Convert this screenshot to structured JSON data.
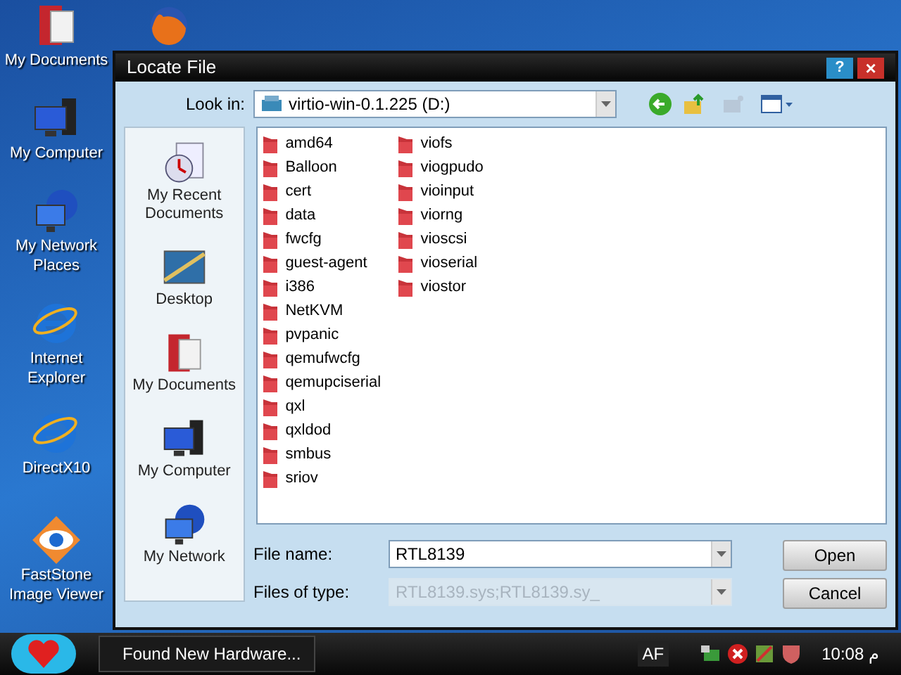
{
  "desktop_icons": [
    {
      "label": "My Documents",
      "kind": "documents"
    },
    {
      "label": "My Computer",
      "kind": "computer"
    },
    {
      "label": "My Network Places",
      "kind": "network"
    },
    {
      "label": "Internet Explorer",
      "kind": "ie"
    },
    {
      "label": "DirectX10",
      "kind": "ie-shortcut"
    },
    {
      "label": "FastStone Image Viewer",
      "kind": "eye"
    }
  ],
  "dialog": {
    "title": "Locate File",
    "help_button": "?",
    "close_button": "×",
    "look_in": {
      "label": "Look in:",
      "value": "virtio-win-0.1.225 (D:)"
    },
    "places": [
      {
        "label": "My Recent Documents",
        "kind": "recent"
      },
      {
        "label": "Desktop",
        "kind": "desktop"
      },
      {
        "label": "My Documents",
        "kind": "documents"
      },
      {
        "label": "My Computer",
        "kind": "computer"
      },
      {
        "label": "My Network",
        "kind": "network"
      }
    ],
    "files": [
      "amd64",
      "Balloon",
      "cert",
      "data",
      "fwcfg",
      "guest-agent",
      "i386",
      "NetKVM",
      "pvpanic",
      "qemufwcfg",
      "qemupciserial",
      "qxl",
      "qxldod",
      "smbus",
      "sriov",
      "viofs",
      "viogpudo",
      "vioinput",
      "viorng",
      "vioscsi",
      "vioserial",
      "viostor"
    ],
    "file_name": {
      "label": "File name:",
      "value": "RTL8139",
      "disabled": false
    },
    "files_of_type": {
      "label": "Files of type:",
      "value": "RTL8139.sys;RTL8139.sy_",
      "disabled": true
    },
    "buttons": [
      "Open",
      "Cancel"
    ]
  },
  "taskbar": {
    "task": "Found New Hardware...",
    "language": "AF",
    "clock": "10:08 م"
  }
}
